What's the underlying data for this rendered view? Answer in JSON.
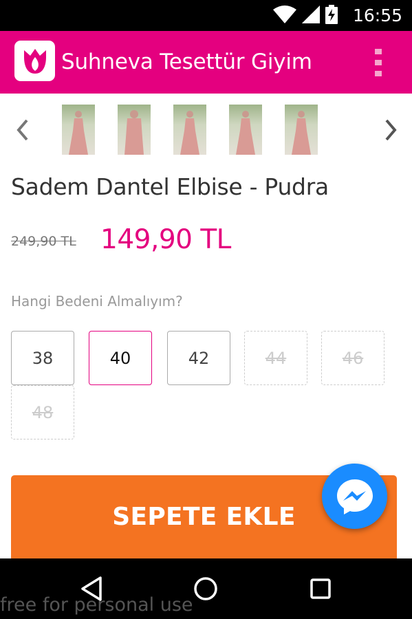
{
  "status_bar": {
    "time": "16:55",
    "icons": [
      "wifi-icon",
      "signal-icon",
      "battery-charging-icon"
    ]
  },
  "app_bar": {
    "title": "Suhneva Tesettür Giyim",
    "logo": "tulip-logo-icon",
    "menu_icon": "overflow-menu-icon",
    "background_color": "#e4007f"
  },
  "gallery": {
    "prev_icon": "chevron-left-icon",
    "next_icon": "chevron-right-icon",
    "thumbnails": [
      "product-photo-1",
      "product-photo-2",
      "product-photo-3",
      "product-photo-4",
      "product-photo-5"
    ]
  },
  "product": {
    "title": "Sadem Dantel Elbise - Pudra",
    "old_price": "249,90 TL",
    "new_price": "149,90 TL",
    "price_color": "#e4007f"
  },
  "sizes": {
    "help_text": "Hangi Bedeni Almalıyım?",
    "options": [
      {
        "label": "38",
        "state": "available"
      },
      {
        "label": "40",
        "state": "selected"
      },
      {
        "label": "42",
        "state": "available"
      },
      {
        "label": "44",
        "state": "unavailable"
      },
      {
        "label": "46",
        "state": "unavailable"
      },
      {
        "label": "48",
        "state": "unavailable"
      }
    ]
  },
  "cart": {
    "add_label": "SEPETE EKLE",
    "button_color": "#f47321"
  },
  "messenger": {
    "icon": "messenger-icon",
    "color": "#1a8cff"
  },
  "nav_bar": {
    "back_icon": "back-triangle-icon",
    "home_icon": "home-circle-icon",
    "recents_icon": "recents-square-icon"
  },
  "watermark": "free for personal use"
}
